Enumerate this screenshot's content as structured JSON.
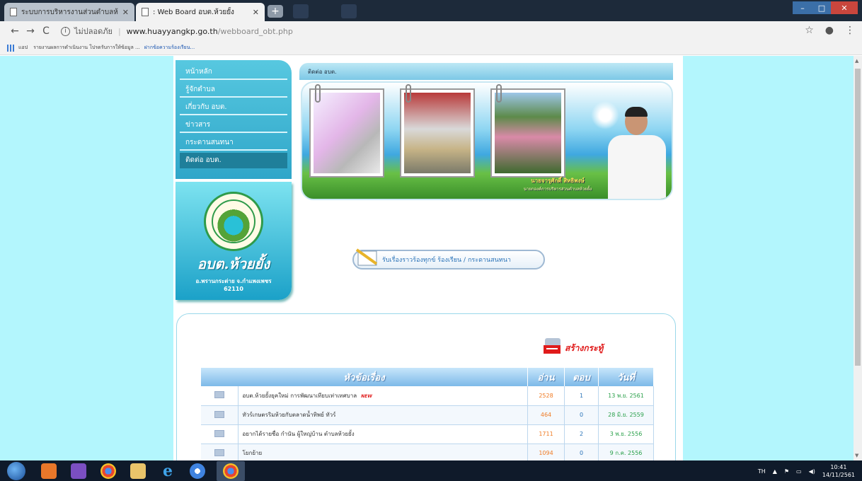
{
  "browser": {
    "tabs": [
      {
        "title": "ระบบการบริหารงานส่วนตำบลห้วยยั้ง อ.พ...",
        "active": false
      },
      {
        "title": ": Web Board อบต.ห้วยยั้ง",
        "active": true
      }
    ],
    "new_tab_label": "+",
    "url_security": "ไม่ปลอดภัย",
    "url_host": "www.huayyangkp.go.th",
    "url_path": "/webboard_obt.php",
    "bookmarks_apps": "แอป",
    "bookmark_text": "รายงานผลการดำเนินงาน โปรดรับการให้ข้อมูล ...",
    "bookmark_link": "ฝากข้อความร้องเรียน..."
  },
  "menu": {
    "items": [
      {
        "label": "หน้าหลัก",
        "current": false
      },
      {
        "label": "รู้จักตำบล",
        "current": false
      },
      {
        "label": "เกี่ยวกับ อบต.",
        "current": false
      },
      {
        "label": "ข่าวสาร",
        "current": false
      },
      {
        "label": "กระดานสนทนา",
        "current": false
      },
      {
        "label": "ติดต่อ อบต.",
        "current": true
      }
    ]
  },
  "logo": {
    "name": "อบต.ห้วยยั้ง",
    "district": "อ.พรานกระต่าย จ.กำแพงเพชร",
    "postcode": "62110"
  },
  "banner": {
    "title": "ติดต่อ อบต.",
    "caption": "นายจารุศักดิ์ สิทธิพงษ์",
    "caption_sub": "นายกองค์การบริหารส่วนตำบลห้วยยั้ง"
  },
  "complaint_button": "รับเรื่องราวร้องทุกข์ ร้องเรียน / กระดานสนทนา",
  "board": {
    "create_label": "สร้างกระทู้",
    "columns": {
      "title": "หัวข้อเรื่อง",
      "read": "อ่าน",
      "reply": "ตอบ",
      "date": "วันที่"
    },
    "rows": [
      {
        "title": "อบต.ห้วยยั้งยุคใหม่ การพัฒนาเทียบเท่าเทศบาล",
        "new_label": "NEW",
        "read": "2528",
        "reply": "1",
        "date": "13 พ.ย. 2561"
      },
      {
        "title": "ทัวร์เกษตรริมห้วยกับตลาดน้ำทิพย์ ทัวร์",
        "new_label": "",
        "read": "464",
        "reply": "0",
        "date": "28 มิ.ย. 2559"
      },
      {
        "title": "อยากได้รายชื่อ กำนัน ผู้ใหญ่บ้าน ตำบลห้วยยั้ง",
        "new_label": "",
        "read": "1711",
        "reply": "2",
        "date": "3 พ.ย. 2556"
      },
      {
        "title": "โยกย้าย",
        "new_label": "",
        "read": "1094",
        "reply": "0",
        "date": "9 ก.ค. 2556"
      }
    ]
  },
  "taskbar": {
    "lang": "TH",
    "time": "10:41",
    "date": "14/11/2561"
  },
  "colors": {
    "page_bg": "#b3f6fd",
    "menu_blue": "#2fa6c9",
    "accent_red": "#e01b1b",
    "read_orange": "#f07a22",
    "date_green": "#2aa04a"
  }
}
